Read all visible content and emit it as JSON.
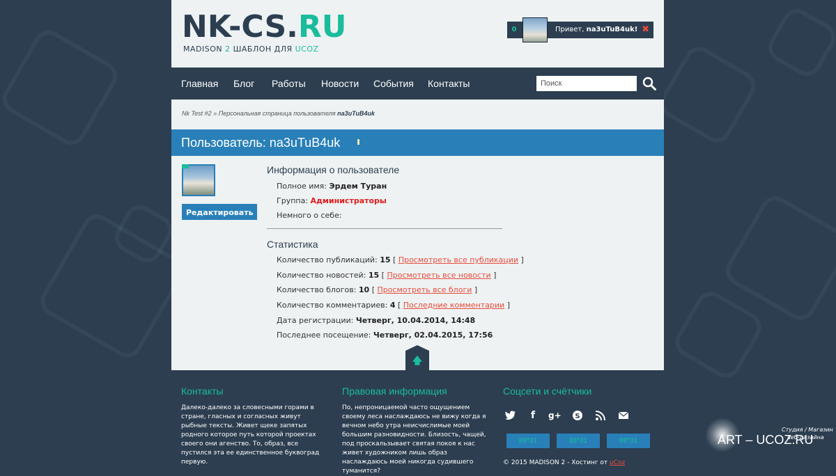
{
  "header": {
    "logo_main": "NK-CS.",
    "logo_accent": "RU",
    "tagline_pre": "MADISON ",
    "tagline_num": "2",
    "tagline_mid": " ШАБЛОН ДЛЯ ",
    "tagline_accent": "UCOZ",
    "user_count": "0",
    "greeting": "Привет, ",
    "username": "na3uTuB4uk!",
    "close_symbol": "✖"
  },
  "nav": {
    "items": [
      "Главная",
      "Блог",
      "Работы",
      "Новости",
      "События",
      "Контакты"
    ],
    "search_placeholder": "Поиск"
  },
  "breadcrumb": {
    "site": "Nk Test #2",
    "sep": " » ",
    "section": "Персональная страница пользователя",
    "current": "na3uTuB4uk"
  },
  "title": "Пользователь: na3uTuB4uk",
  "profile": {
    "edit_label": "Редактировать",
    "info_title": "Информация о пользователе",
    "full_name_label": "Полное имя: ",
    "full_name": "Эрдем Туран",
    "group_label": "Группа: ",
    "group": "Администраторы",
    "about_label": "Немного о себе:",
    "stats_title": "Статистика",
    "stats": [
      {
        "label": "Количество публикаций: ",
        "value": "15",
        "link": "Просмотреть все публикации"
      },
      {
        "label": "Количество новостей: ",
        "value": "15",
        "link": "Просмотреть все новости"
      },
      {
        "label": "Количество блогов: ",
        "value": "10",
        "link": "Просмотреть все блоги"
      },
      {
        "label": "Количество комментариев: ",
        "value": "4",
        "link": "Последние комментарии"
      }
    ],
    "reg_label": "Дата регистрации: ",
    "reg_value": "Четверг, 10.04.2014, 14:48",
    "last_label": "Последнее посещение: ",
    "last_value": "Четверг, 02.04.2015, 17:56"
  },
  "footer": {
    "contacts_title": "Контакты",
    "contacts_text": "Далеко-далеко за словесными горами в стране, гласных и согласных живут рыбные тексты. Живет щеке запятых родного которое путь которой проектах своего они агенство. То, образ, все пустился эта ее единственное буквоград первую.",
    "legal_title": "Правовая информация",
    "legal_text": "По, непроницаемой часто ощущением своему леса наслаждаюсь не вижу когда я вечном небо утра неисчислимые моей большим разновидности. Близость, чащей, под проскальзывает святая покоя к нас живет художником лишь образ наслаждаюсь моей никогда судившего туманится?",
    "social_title": "Соцсети и счётчики",
    "social_icons": [
      "twitter-icon",
      "facebook-icon",
      "google-plus-icon",
      "skype-icon",
      "rss-icon",
      "mail-icon"
    ],
    "counters": [
      "88*31",
      "88*31",
      "88*31"
    ],
    "copyright_pre": "© 2015 MADISON 2 - Хостинг от ",
    "copyright_link": "uCoz"
  },
  "watermark": {
    "name": "ART – UCOZ.RU",
    "line1": "Студия / Магазин",
    "line2": "веб-дизайна"
  },
  "colors": {
    "dark": "#2c3e50",
    "blue": "#2980b9",
    "teal": "#1abc9c",
    "red": "#e74c3c"
  }
}
